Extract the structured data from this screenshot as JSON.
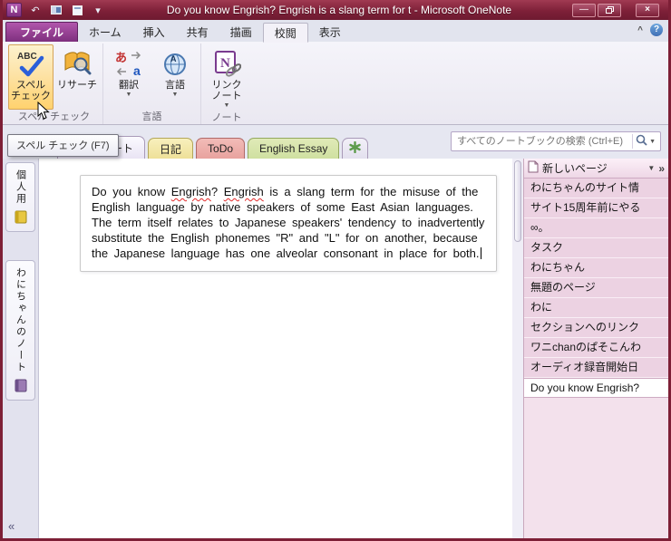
{
  "window": {
    "title": "Do you know Engrish? Engrish is a slang term for t - Microsoft OneNote"
  },
  "ribbon": {
    "tabs": [
      {
        "label": "ファイル"
      },
      {
        "label": "ホーム"
      },
      {
        "label": "挿入"
      },
      {
        "label": "共有"
      },
      {
        "label": "描画"
      },
      {
        "label": "校閲"
      },
      {
        "label": "表示"
      }
    ],
    "groups": {
      "spelling": {
        "label": "スペル チェック",
        "spellcheck_label_1": "スペル",
        "spellcheck_label_2": "チェック",
        "research_label": "リサーチ"
      },
      "language": {
        "label": "言語",
        "translate_label": "翻訳",
        "language_label": "言語"
      },
      "notes": {
        "label": "ノート",
        "linked_label_1": "リンク",
        "linked_label_2": "ノート"
      }
    }
  },
  "tooltip": {
    "text": "スペル チェック (F7)"
  },
  "section_bar": {
    "tabs": [
      {
        "label": "ノート"
      },
      {
        "label": "日記"
      },
      {
        "label": "ToDo"
      },
      {
        "label": "English Essay"
      }
    ],
    "search_placeholder": "すべてのノートブックの検索 (Ctrl+E)"
  },
  "left_sidebar": {
    "notebooks": [
      {
        "label": "個人用"
      },
      {
        "label": "わにちゃんのノート"
      }
    ]
  },
  "note": {
    "segments": [
      {
        "t": "Do you know ",
        "sp": false
      },
      {
        "t": "Engrish",
        "sp": true
      },
      {
        "t": "? ",
        "sp": false
      },
      {
        "t": "Engrish",
        "sp": true
      },
      {
        "t": " is a slang term for the misuse of the English language by native speakers of some East Asian languages. The term itself relates to Japanese speakers' tendency to inadvertently substitute the English phonemes \"R\" and \"L\" for on another, because the Japanese language has one alveolar consonant in place for both.",
        "sp": false
      }
    ]
  },
  "page_panel": {
    "new_page_label": "新しいページ",
    "pages": [
      {
        "label": "わにちゃんのサイト情",
        "selected": false
      },
      {
        "label": "サイト15周年前にやる",
        "selected": false
      },
      {
        "label": "∞。",
        "selected": false
      },
      {
        "label": "タスク",
        "selected": false
      },
      {
        "label": "わにちゃん",
        "selected": false
      },
      {
        "label": "無題のページ",
        "selected": false
      },
      {
        "label": "わに",
        "selected": false
      },
      {
        "label": "セクションへのリンク",
        "selected": false
      },
      {
        "label": "ワニchanのぱそこんわ",
        "selected": false
      },
      {
        "label": "オーディオ録音開始日",
        "selected": false
      },
      {
        "label": "Do you know Engrish?",
        "selected": true
      }
    ]
  },
  "colors": {
    "titlebar_red": "#7e2038",
    "file_tab_purple": "#8e3a8e",
    "panel_pink": "#f3e1ec",
    "page_item_pink": "#ecd2e2",
    "tab_yellow": "#eee098",
    "tab_red": "#e8a29e",
    "tab_green": "#cfe0a0",
    "hover_orange": "#fde3a7",
    "misspell_red": "#e22929"
  }
}
